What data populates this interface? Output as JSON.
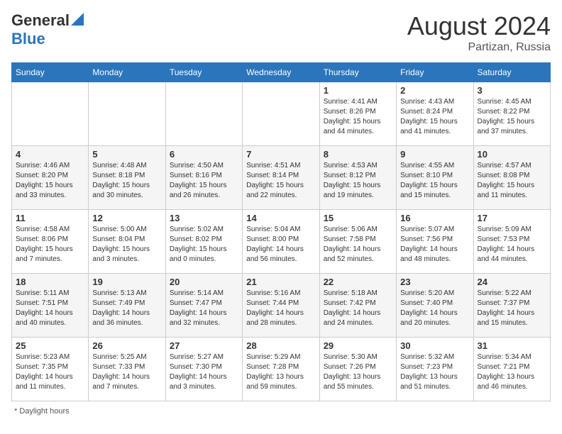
{
  "header": {
    "logo_line1": "General",
    "logo_line2": "Blue",
    "month_year": "August 2024",
    "location": "Partizan, Russia"
  },
  "footer": {
    "note": "Daylight hours"
  },
  "days_of_week": [
    "Sunday",
    "Monday",
    "Tuesday",
    "Wednesday",
    "Thursday",
    "Friday",
    "Saturday"
  ],
  "weeks": [
    [
      {
        "day": "",
        "info": ""
      },
      {
        "day": "",
        "info": ""
      },
      {
        "day": "",
        "info": ""
      },
      {
        "day": "",
        "info": ""
      },
      {
        "day": "1",
        "info": "Sunrise: 4:41 AM\nSunset: 8:26 PM\nDaylight: 15 hours\nand 44 minutes."
      },
      {
        "day": "2",
        "info": "Sunrise: 4:43 AM\nSunset: 8:24 PM\nDaylight: 15 hours\nand 41 minutes."
      },
      {
        "day": "3",
        "info": "Sunrise: 4:45 AM\nSunset: 8:22 PM\nDaylight: 15 hours\nand 37 minutes."
      }
    ],
    [
      {
        "day": "4",
        "info": "Sunrise: 4:46 AM\nSunset: 8:20 PM\nDaylight: 15 hours\nand 33 minutes."
      },
      {
        "day": "5",
        "info": "Sunrise: 4:48 AM\nSunset: 8:18 PM\nDaylight: 15 hours\nand 30 minutes."
      },
      {
        "day": "6",
        "info": "Sunrise: 4:50 AM\nSunset: 8:16 PM\nDaylight: 15 hours\nand 26 minutes."
      },
      {
        "day": "7",
        "info": "Sunrise: 4:51 AM\nSunset: 8:14 PM\nDaylight: 15 hours\nand 22 minutes."
      },
      {
        "day": "8",
        "info": "Sunrise: 4:53 AM\nSunset: 8:12 PM\nDaylight: 15 hours\nand 19 minutes."
      },
      {
        "day": "9",
        "info": "Sunrise: 4:55 AM\nSunset: 8:10 PM\nDaylight: 15 hours\nand 15 minutes."
      },
      {
        "day": "10",
        "info": "Sunrise: 4:57 AM\nSunset: 8:08 PM\nDaylight: 15 hours\nand 11 minutes."
      }
    ],
    [
      {
        "day": "11",
        "info": "Sunrise: 4:58 AM\nSunset: 8:06 PM\nDaylight: 15 hours\nand 7 minutes."
      },
      {
        "day": "12",
        "info": "Sunrise: 5:00 AM\nSunset: 8:04 PM\nDaylight: 15 hours\nand 3 minutes."
      },
      {
        "day": "13",
        "info": "Sunrise: 5:02 AM\nSunset: 8:02 PM\nDaylight: 15 hours\nand 0 minutes."
      },
      {
        "day": "14",
        "info": "Sunrise: 5:04 AM\nSunset: 8:00 PM\nDaylight: 14 hours\nand 56 minutes."
      },
      {
        "day": "15",
        "info": "Sunrise: 5:06 AM\nSunset: 7:58 PM\nDaylight: 14 hours\nand 52 minutes."
      },
      {
        "day": "16",
        "info": "Sunrise: 5:07 AM\nSunset: 7:56 PM\nDaylight: 14 hours\nand 48 minutes."
      },
      {
        "day": "17",
        "info": "Sunrise: 5:09 AM\nSunset: 7:53 PM\nDaylight: 14 hours\nand 44 minutes."
      }
    ],
    [
      {
        "day": "18",
        "info": "Sunrise: 5:11 AM\nSunset: 7:51 PM\nDaylight: 14 hours\nand 40 minutes."
      },
      {
        "day": "19",
        "info": "Sunrise: 5:13 AM\nSunset: 7:49 PM\nDaylight: 14 hours\nand 36 minutes."
      },
      {
        "day": "20",
        "info": "Sunrise: 5:14 AM\nSunset: 7:47 PM\nDaylight: 14 hours\nand 32 minutes."
      },
      {
        "day": "21",
        "info": "Sunrise: 5:16 AM\nSunset: 7:44 PM\nDaylight: 14 hours\nand 28 minutes."
      },
      {
        "day": "22",
        "info": "Sunrise: 5:18 AM\nSunset: 7:42 PM\nDaylight: 14 hours\nand 24 minutes."
      },
      {
        "day": "23",
        "info": "Sunrise: 5:20 AM\nSunset: 7:40 PM\nDaylight: 14 hours\nand 20 minutes."
      },
      {
        "day": "24",
        "info": "Sunrise: 5:22 AM\nSunset: 7:37 PM\nDaylight: 14 hours\nand 15 minutes."
      }
    ],
    [
      {
        "day": "25",
        "info": "Sunrise: 5:23 AM\nSunset: 7:35 PM\nDaylight: 14 hours\nand 11 minutes."
      },
      {
        "day": "26",
        "info": "Sunrise: 5:25 AM\nSunset: 7:33 PM\nDaylight: 14 hours\nand 7 minutes."
      },
      {
        "day": "27",
        "info": "Sunrise: 5:27 AM\nSunset: 7:30 PM\nDaylight: 14 hours\nand 3 minutes."
      },
      {
        "day": "28",
        "info": "Sunrise: 5:29 AM\nSunset: 7:28 PM\nDaylight: 13 hours\nand 59 minutes."
      },
      {
        "day": "29",
        "info": "Sunrise: 5:30 AM\nSunset: 7:26 PM\nDaylight: 13 hours\nand 55 minutes."
      },
      {
        "day": "30",
        "info": "Sunrise: 5:32 AM\nSunset: 7:23 PM\nDaylight: 13 hours\nand 51 minutes."
      },
      {
        "day": "31",
        "info": "Sunrise: 5:34 AM\nSunset: 7:21 PM\nDaylight: 13 hours\nand 46 minutes."
      }
    ]
  ]
}
